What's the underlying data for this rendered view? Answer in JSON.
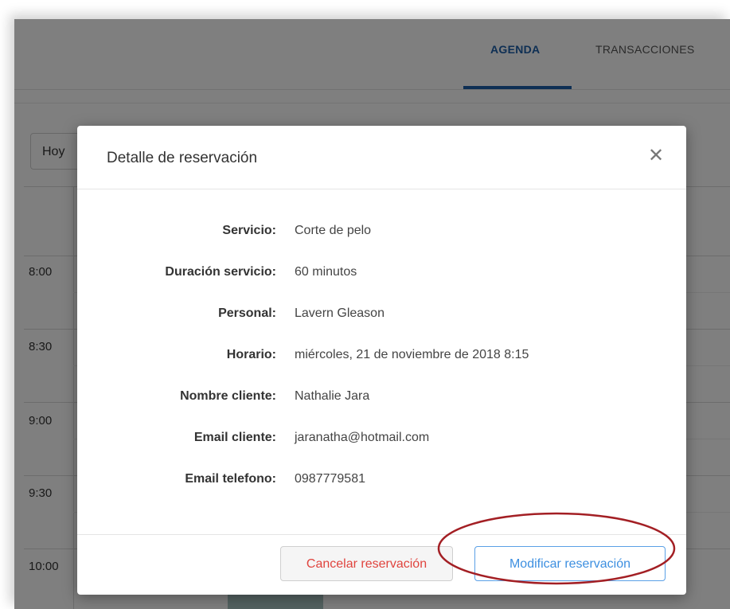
{
  "nav": {
    "tab_agenda": "AGENDA",
    "tab_transactions": "TRANSACCIONES"
  },
  "toolbar": {
    "today_label": "Hoy"
  },
  "calendar": {
    "times": [
      "8:00",
      "8:30",
      "9:00",
      "9:30",
      "10:00"
    ]
  },
  "modal": {
    "title": "Detalle de reservación",
    "close_icon": "close-icon",
    "details": [
      {
        "label": "Servicio:",
        "value": "Corte de pelo"
      },
      {
        "label": "Duración servicio:",
        "value": "60 minutos"
      },
      {
        "label": "Personal:",
        "value": "Lavern Gleason"
      },
      {
        "label": "Horario:",
        "value": "miércoles, 21 de noviembre de 2018 8:15"
      },
      {
        "label": "Nombre cliente:",
        "value": "Nathalie Jara"
      },
      {
        "label": "Email cliente:",
        "value": "jaranatha@hotmail.com"
      },
      {
        "label": "Email telefono:",
        "value": "0987779581"
      }
    ],
    "cancel_label": "Cancelar reservación",
    "modify_label": "Modificar reservación"
  },
  "colors": {
    "accent": "#1d5fa8",
    "cancel_text": "#e0443e",
    "modify_border": "#5aa0e6",
    "annotation": "#a31f24"
  }
}
